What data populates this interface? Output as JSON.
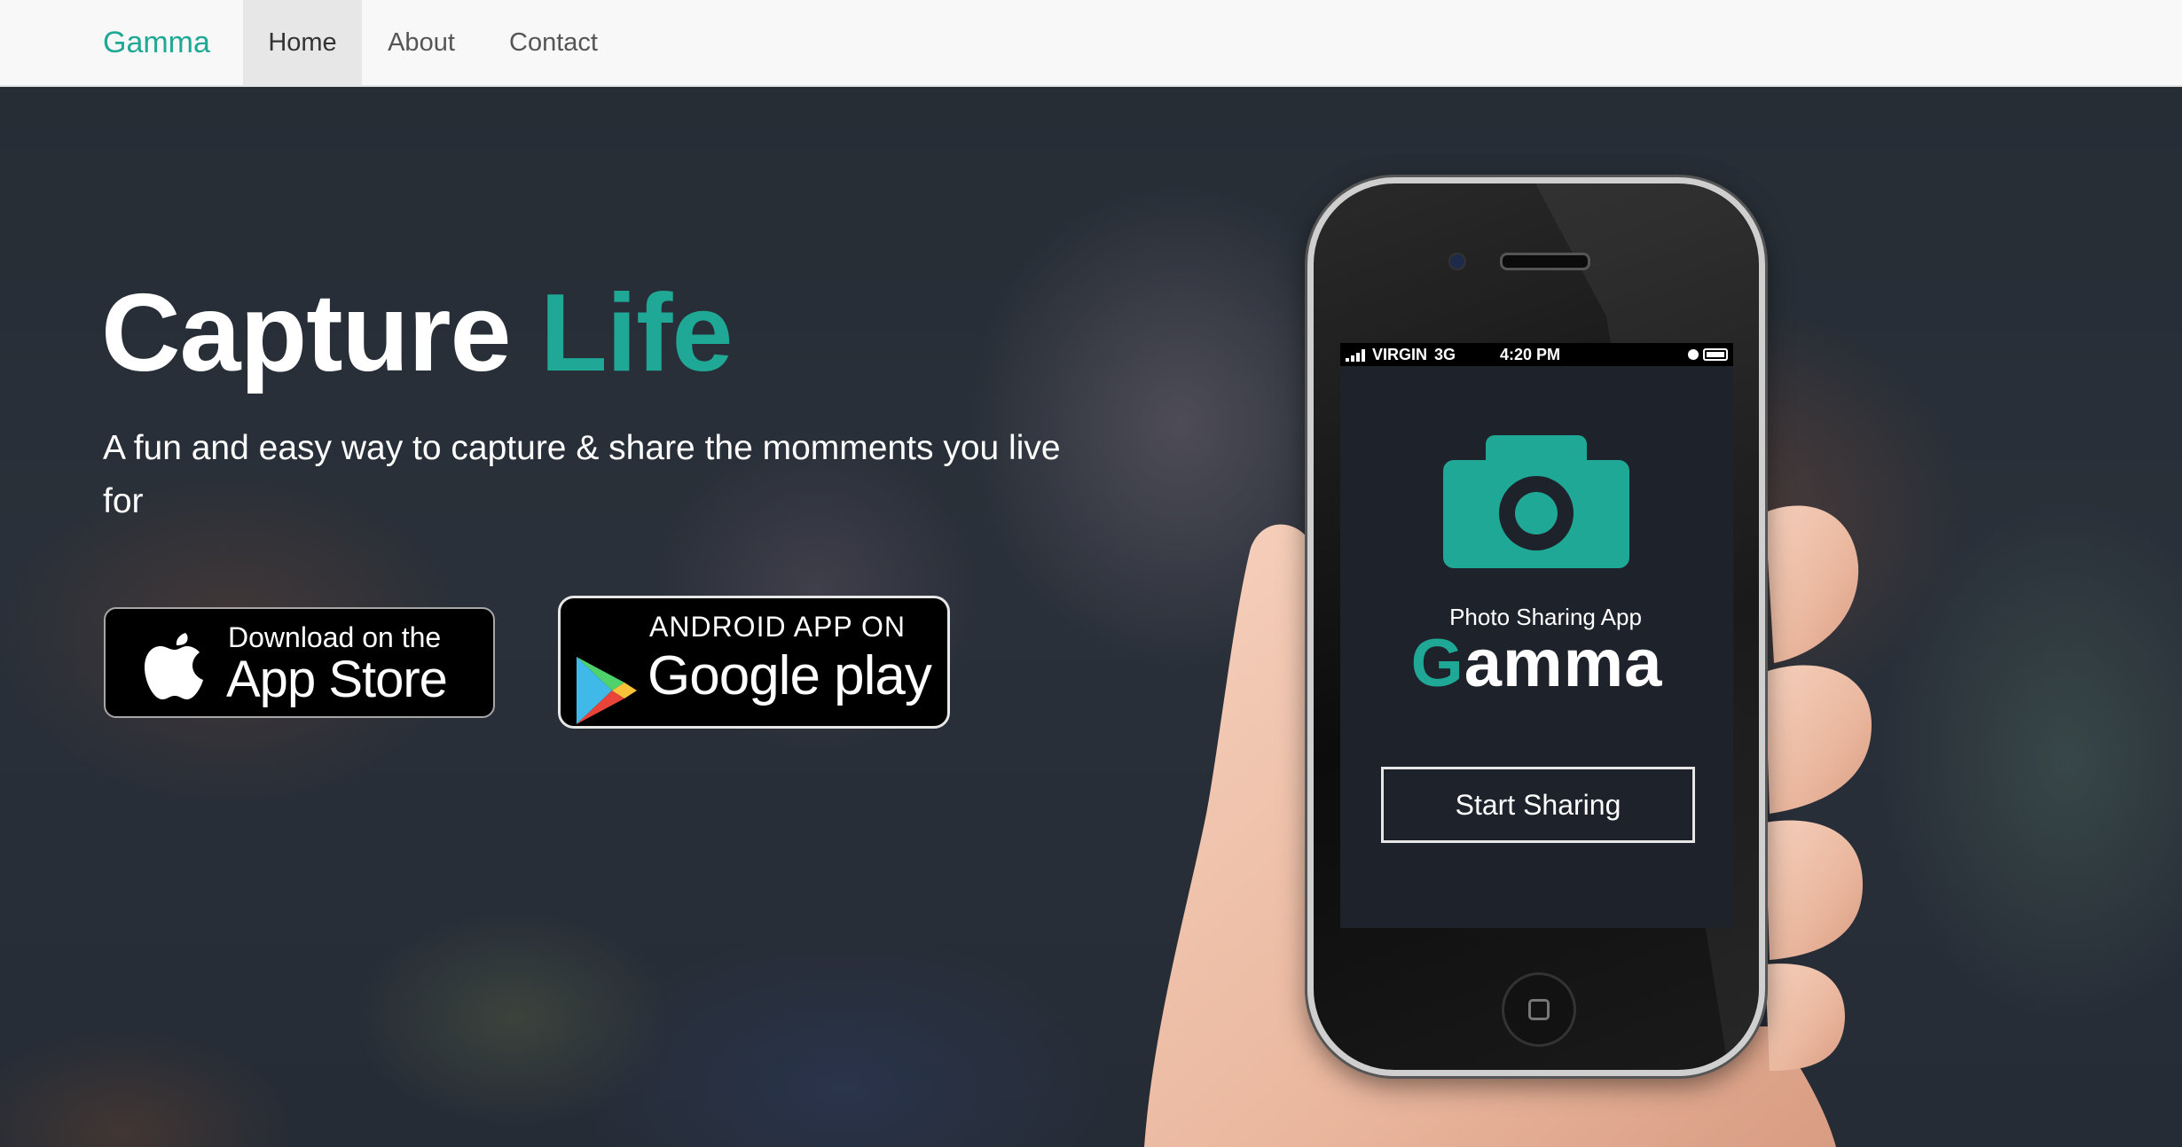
{
  "navbar": {
    "brand": "Gamma",
    "items": [
      {
        "label": "Home",
        "active": true
      },
      {
        "label": "About",
        "active": false
      },
      {
        "label": "Contact",
        "active": false
      }
    ]
  },
  "hero": {
    "title_main": "Capture",
    "title_accent": "Life",
    "subtitle": "A fun and easy way to capture & share the momments you live for",
    "app_store": {
      "top": "Download on the",
      "big": "App Store",
      "icon": "apple-icon"
    },
    "google_play": {
      "top": "ANDROID APP ON",
      "big": "Google play",
      "icon": "google-play-icon"
    }
  },
  "phone": {
    "status": {
      "carrier": "VIRGIN",
      "network": "3G",
      "time": "4:20 PM"
    },
    "app_tagline": "Photo Sharing App",
    "app_name_first": "G",
    "app_name_rest": "amma",
    "start_button": "Start Sharing",
    "icon": "camera-icon"
  },
  "colors": {
    "accent": "#1fa896",
    "navbar_bg": "#f8f8f8",
    "hero_bg": "#2a3039"
  }
}
